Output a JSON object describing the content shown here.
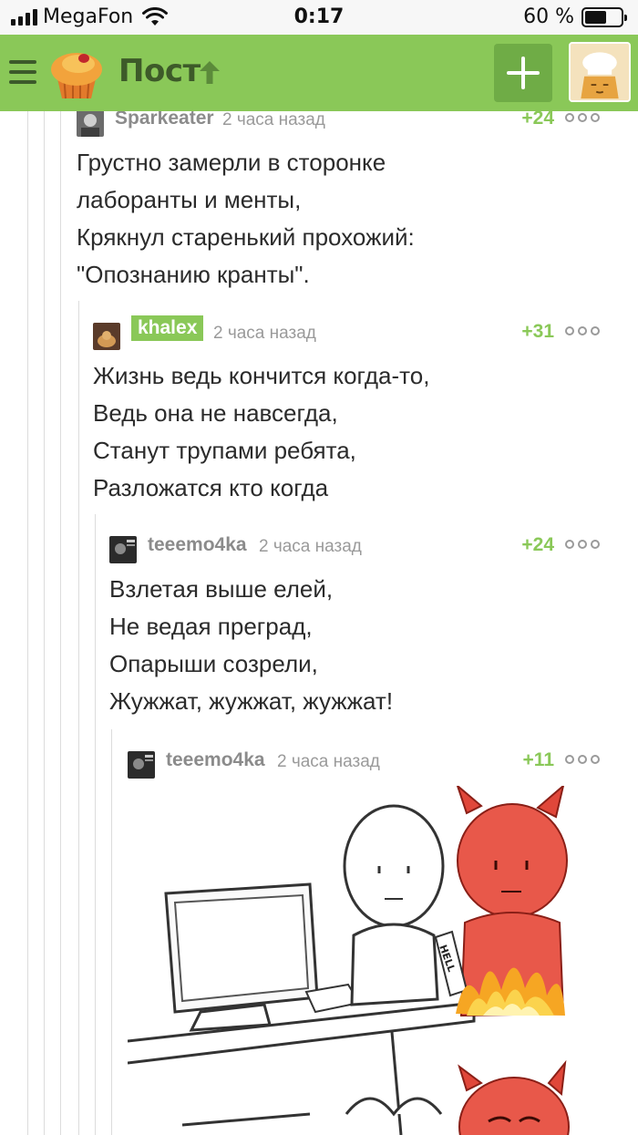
{
  "status_bar": {
    "carrier": "MegaFon",
    "time": "0:17",
    "battery": "60 %",
    "battery_level": 0.6
  },
  "header": {
    "title": "Пост",
    "brand_color": "#8ac858"
  },
  "comments": [
    {
      "user": "Sparkeater",
      "time": "2 часа назад",
      "rating": "+24",
      "lines": [
        "Грустно замерли в сторонке",
        "лаборанты и менты,",
        "Крякнул старенький прохожий:",
        "\"Опознанию кранты\"."
      ]
    },
    {
      "user": "khalex",
      "time": "2 часа назад",
      "rating": "+31",
      "lines": [
        "Жизнь ведь кончится когда-то,",
        "Ведь она не навсегда,",
        "Станут трупами ребята,",
        "Разложатся кто когда"
      ]
    },
    {
      "user": "teeemo4ka",
      "time": "2 часа назад",
      "rating": "+24",
      "lines": [
        "Взлетая выше елей,",
        "Не ведая преград,",
        "Опарыши созрели,",
        "Жужжат, жужжат, жужжат!"
      ]
    },
    {
      "user": "teeemo4ka",
      "time": "2 часа назад",
      "rating": "+11",
      "image_text": "HELL"
    }
  ]
}
